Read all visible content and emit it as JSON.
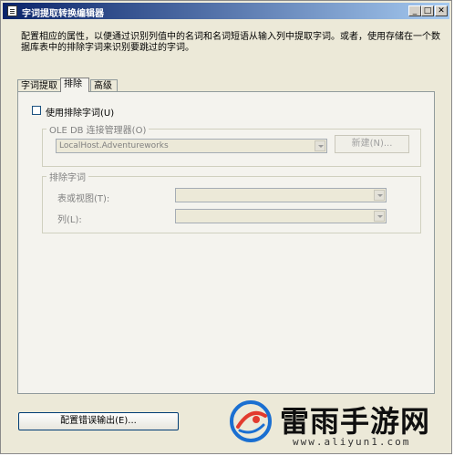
{
  "window": {
    "title": "字词提取转换编辑器"
  },
  "description": "配置相应的属性，以便通过识别列值中的名词和名词短语从输入列中提取字词。或者，使用存储在一个数据库表中的排除字词来识别要跳过的字词。",
  "tabs": [
    {
      "label": "字词提取"
    },
    {
      "label": "排除",
      "active": true
    },
    {
      "label": "高级"
    }
  ],
  "exclusion": {
    "use_checkbox_label": "使用排除字词(U)",
    "use_checked": false,
    "oledb_group_title": "OLE DB 连接管理器(O)",
    "connection_value": "LocalHost.Adventureworks",
    "new_button_label": "新建(N)...",
    "terms_group_title": "排除字词",
    "table_label": "表或视图(T):",
    "table_value": "",
    "column_label": "列(L):",
    "column_value": ""
  },
  "footer": {
    "error_output_button_label": "配置错误输出(E)..."
  },
  "watermark": {
    "name": "雷雨手游网",
    "url": "www.aliyun1.com"
  }
}
